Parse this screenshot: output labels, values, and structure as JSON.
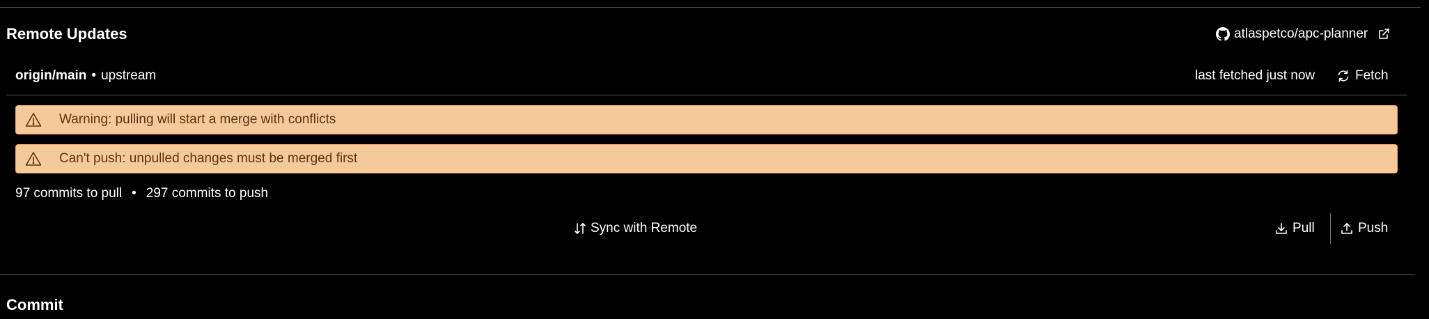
{
  "remote": {
    "section_title": "Remote Updates",
    "repo_name": "atlaspetco/apc-planner",
    "branch": "origin/main",
    "bullet": "•",
    "upstream": "upstream",
    "last_fetched": "last fetched just now",
    "fetch_label": "Fetch"
  },
  "banners": [
    {
      "icon": "warning-triangle-icon",
      "text": "Warning: pulling will start a merge with conflicts"
    },
    {
      "icon": "warning-triangle-icon",
      "text": "Can't push: unpulled changes must be merged first"
    }
  ],
  "counts": {
    "pull_text": "97 commits to pull",
    "bullet": "•",
    "push_text": "297 commits to push"
  },
  "actions": {
    "sync_label": "Sync with Remote",
    "pull_label": "Pull",
    "push_label": "Push"
  },
  "commit": {
    "section_title": "Commit"
  },
  "colors": {
    "background": "#000000",
    "banner_bg": "#f6c99b",
    "banner_text": "#5a3410",
    "divider": "#555555"
  }
}
